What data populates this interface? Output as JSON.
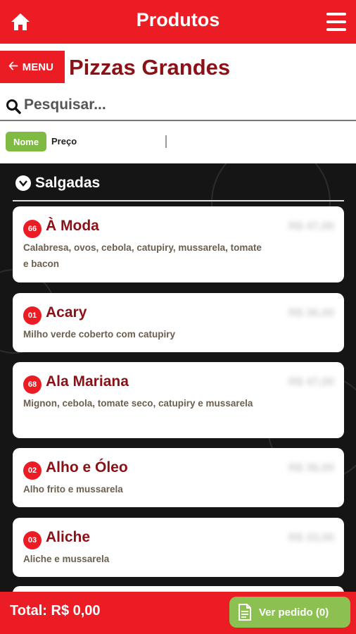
{
  "header": {
    "title": "Produtos",
    "home_icon": "home-icon",
    "menu_icon": "hamburger-icon"
  },
  "nav": {
    "back_label": "MENU",
    "page_title": "Pizzas Grandes"
  },
  "search": {
    "placeholder": "Pesquisar..."
  },
  "sort": {
    "name_label": "Nome",
    "price_label": "Preço",
    "active": "Nome"
  },
  "section": {
    "title": "Salgadas"
  },
  "products": [
    {
      "code": "66",
      "name": "À Moda",
      "price": "R$ 47,00",
      "description": "Calabresa, ovos, cebola, catupiry, mussarela, tomate e bacon"
    },
    {
      "code": "01",
      "name": "Acary",
      "price": "R$ 36,00",
      "description": "Milho verde coberto com catupiry"
    },
    {
      "code": "68",
      "name": "Ala Mariana",
      "price": "R$ 47,00",
      "description": "Mignon, cebola, tomate seco, catupiry e mussarela"
    },
    {
      "code": "02",
      "name": "Alho e Óleo",
      "price": "R$ 36,00",
      "description": "Alho frito e mussarela"
    },
    {
      "code": "03",
      "name": "Aliche",
      "price": "R$ 33,00",
      "description": "Aliche e mussarela"
    }
  ],
  "footer": {
    "total": "Total: R$ 0,00",
    "order_button": "Ver pedido (0)"
  },
  "colors": {
    "brand_red": "#ec1c24",
    "dark_red": "#8b1117",
    "green": "#7fba42",
    "background": "#151515"
  }
}
